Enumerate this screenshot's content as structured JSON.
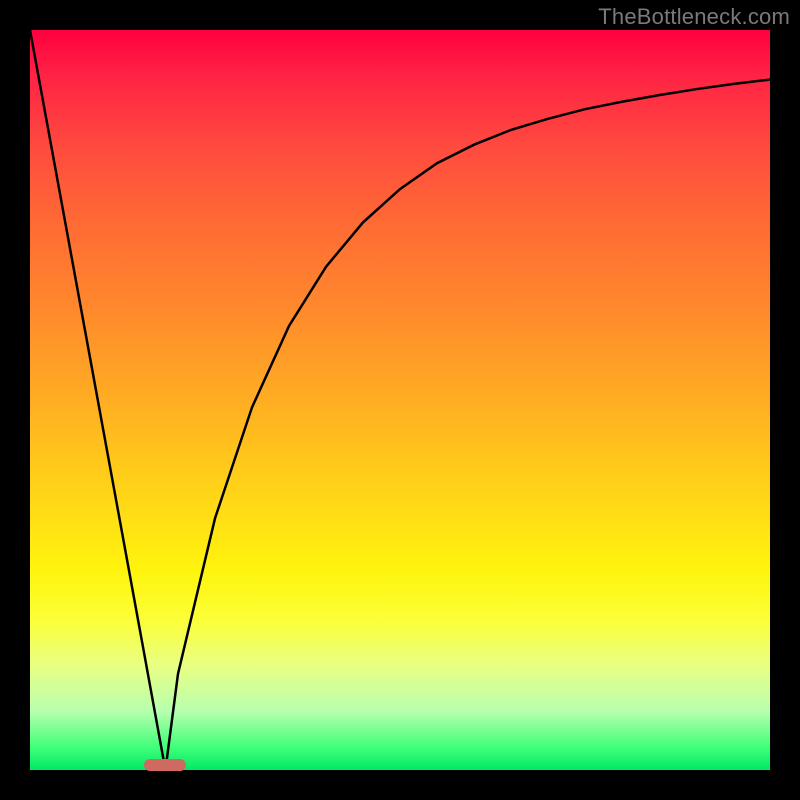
{
  "watermark": "TheBottleneck.com",
  "colors": {
    "frame": "#000000",
    "gradient_top": "#ff003f",
    "gradient_bottom": "#00e965",
    "curve": "#000000",
    "marker": "#cf6a63"
  },
  "chart_data": {
    "type": "line",
    "title": "",
    "xlabel": "",
    "ylabel": "",
    "xlim": [
      0,
      1
    ],
    "ylim": [
      0,
      1
    ],
    "x": [
      0.0,
      0.05,
      0.1,
      0.15,
      0.183,
      0.2,
      0.25,
      0.3,
      0.35,
      0.4,
      0.45,
      0.5,
      0.55,
      0.6,
      0.65,
      0.7,
      0.75,
      0.8,
      0.85,
      0.9,
      0.95,
      1.0
    ],
    "series": [
      {
        "name": "left-leg",
        "x": [
          0.0,
          0.05,
          0.1,
          0.15,
          0.183
        ],
        "y": [
          1.0,
          0.727,
          0.454,
          0.181,
          0.0
        ]
      },
      {
        "name": "right-curve",
        "x": [
          0.183,
          0.2,
          0.25,
          0.3,
          0.35,
          0.4,
          0.45,
          0.5,
          0.55,
          0.6,
          0.65,
          0.7,
          0.75,
          0.8,
          0.85,
          0.9,
          0.95,
          1.0
        ],
        "y": [
          0.0,
          0.13,
          0.34,
          0.49,
          0.6,
          0.68,
          0.74,
          0.785,
          0.82,
          0.845,
          0.865,
          0.88,
          0.893,
          0.903,
          0.912,
          0.92,
          0.927,
          0.933
        ]
      }
    ],
    "marker": {
      "x": 0.183,
      "y": 0.0
    },
    "legend": false,
    "grid": false
  }
}
